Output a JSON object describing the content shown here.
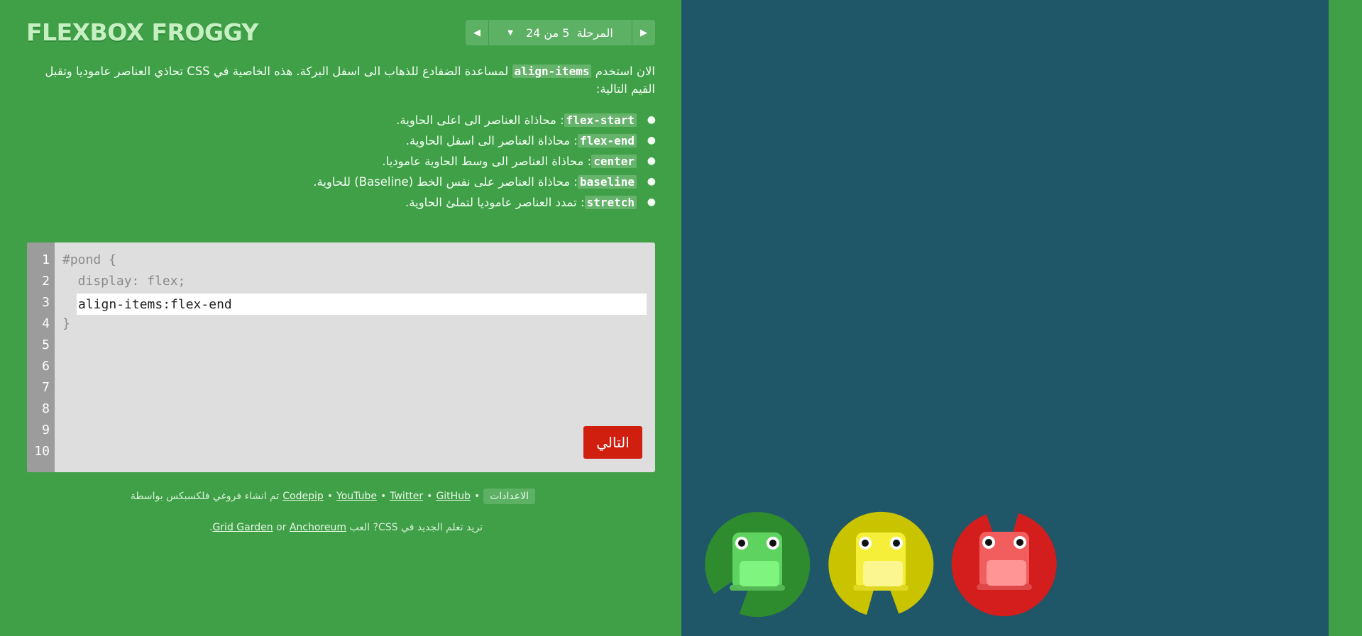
{
  "app": {
    "logo": "FLEXBOX FROGGY"
  },
  "level_nav": {
    "label": "المرحلة  5 من 24",
    "prev_icon": "triangle-left-icon",
    "next_icon": "triangle-right-icon",
    "dropdown_icon": "caret-down-icon"
  },
  "instructions": {
    "intro_before": "الان استخدم ",
    "intro_code": "align-items",
    "intro_after": " لمساعدة الضفادع للذهاب الى اسفل البركة. هذه الخاصية في CSS تحاذي العناصر عاموديا وتقبل القيم التالية:",
    "items": [
      {
        "code": "flex-start",
        "text": ": محاذاة العناصر الى اعلى الحاوية."
      },
      {
        "code": "flex-end",
        "text": ": محاذاة العناصر الى اسفل الحاوية."
      },
      {
        "code": "center",
        "text": ": محاذاة العناصر الى وسط الحاوية عاموديا."
      },
      {
        "code": "baseline",
        "text": ": محاذاة العناصر على نفس الخط (Baseline) للحاوية."
      },
      {
        "code": "stretch",
        "text": ": تمدد العناصر عاموديا لتملئ الحاوية."
      }
    ]
  },
  "editor": {
    "line_numbers": [
      "1",
      "2",
      "3",
      "4",
      "5",
      "6",
      "7",
      "8",
      "9",
      "10"
    ],
    "line1": "#pond {",
    "line2": "  display: flex;",
    "input_value": "align-items:flex-end",
    "line4": "}",
    "next_label": "التالي"
  },
  "footer": {
    "settings_label": "الاعدادات",
    "bullet": "•",
    "links": [
      "GitHub",
      "Twitter",
      "YouTube",
      "Codepip"
    ],
    "credit_text": "تم انشاء فروغي فلكسبكس بواسطة",
    "learn_text": "تريد تعلم الجديد في CSS? العب",
    "learn_links": [
      "Grid Garden",
      "Anchoreum"
    ],
    "or_text": "or",
    "period": "."
  },
  "pond": {
    "background": "#1f5768",
    "frogs": [
      {
        "color": "green",
        "pad": "#2e8b2e",
        "body": "#5fd35f"
      },
      {
        "color": "yellow",
        "pad": "#c9c300",
        "body": "#f5ef3a"
      },
      {
        "color": "red",
        "pad": "#d41d1d",
        "body": "#f25d5d"
      }
    ]
  }
}
